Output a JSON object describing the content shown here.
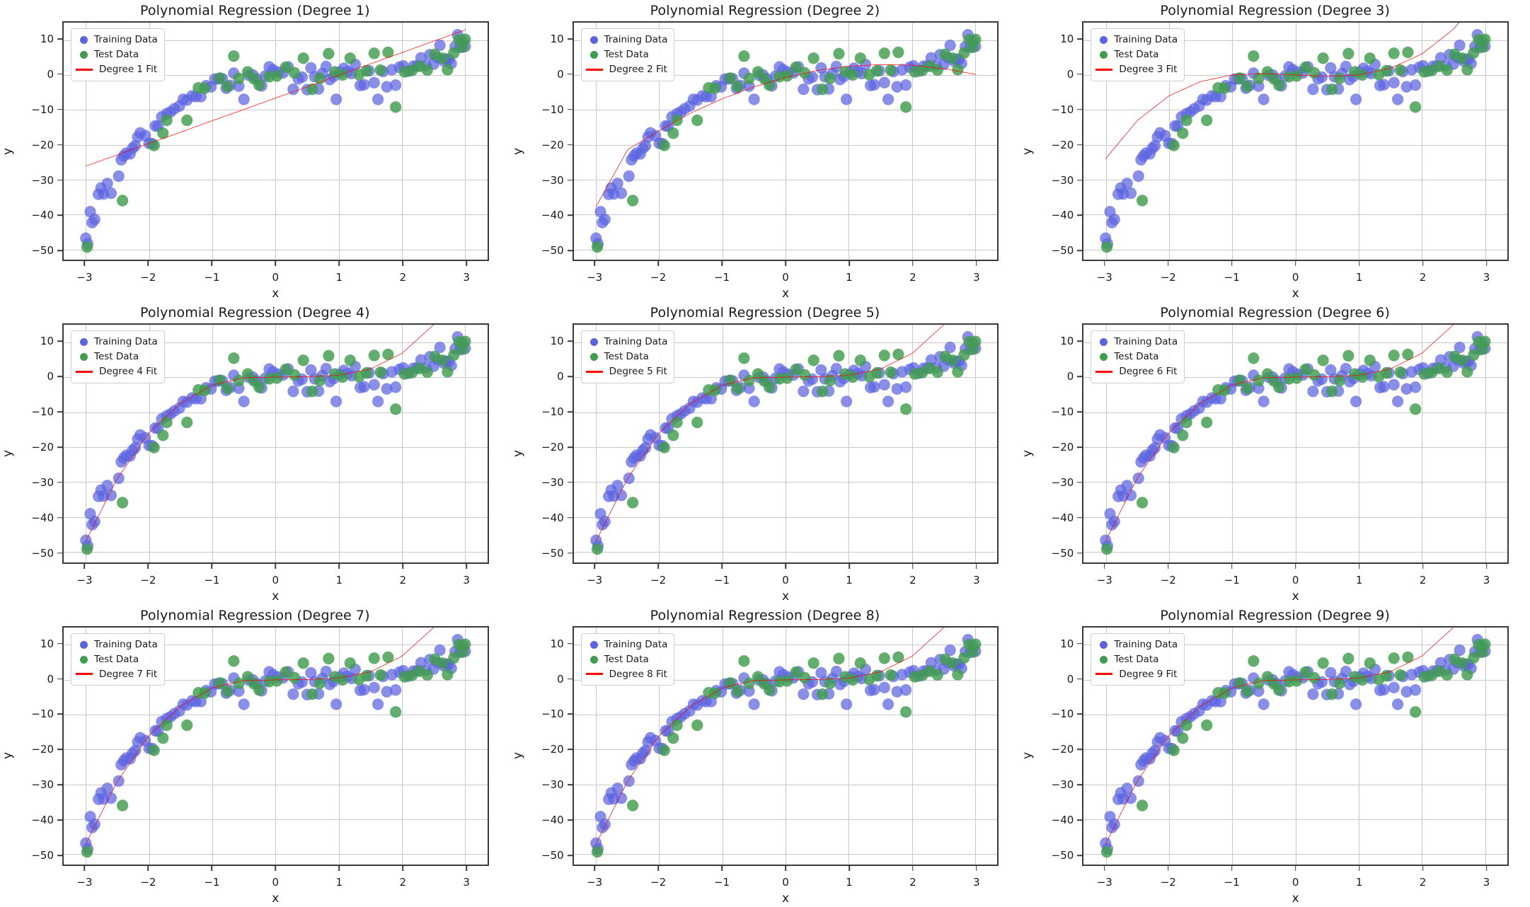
{
  "figure": {
    "layout": "3x3 grid of subplots",
    "rows": 3,
    "cols": 3
  },
  "style": {
    "train_color": "#5B64E0",
    "test_color": "#3F9E4D",
    "fit_color": "#FF0000",
    "grid_color": "#c9c9c9",
    "spine_color": "#3a3a3a",
    "background": "#ffffff"
  },
  "axes_common": {
    "xlabel": "x",
    "ylabel": "y",
    "xticks": [
      "−3",
      "−2",
      "−1",
      "0",
      "1",
      "2",
      "3"
    ],
    "xtick_values": [
      -3,
      -2,
      -1,
      0,
      1,
      2,
      3
    ],
    "yticks": [
      "−50",
      "−40",
      "−30",
      "−20",
      "−10",
      "0",
      "10"
    ],
    "ytick_values": [
      -50,
      -40,
      -30,
      -20,
      -10,
      0,
      10
    ],
    "xlim": [
      -3.35,
      3.35
    ],
    "ylim": [
      -53,
      15
    ],
    "grid": true
  },
  "legend_common": {
    "position": "upper left",
    "train_label": "Training Data",
    "test_label": "Test Data",
    "fit_label_template": "Degree {n} Fit"
  },
  "chart_data": [
    {
      "type": "scatter",
      "index": 0,
      "degree": 1,
      "title": "Polynomial Regression (Degree 1)",
      "xlabel": "x",
      "ylabel": "y",
      "xlim": [
        -3.35,
        3.35
      ],
      "ylim": [
        -53,
        15
      ],
      "grid": true,
      "legend": {
        "position": "upper left",
        "entries": [
          "Training Data",
          "Test Data",
          "Degree 1 Fit"
        ]
      },
      "series": [
        {
          "name": "Training Data",
          "marker": "circle",
          "color": "#5B64E0"
        },
        {
          "name": "Test Data",
          "marker": "circle",
          "color": "#3F9E4D"
        },
        {
          "name": "Degree 1 Fit",
          "marker": "line",
          "color": "#FF0000"
        }
      ],
      "fit_coefficients_highest_first": [
        6.5,
        -6.6
      ],
      "fit_curve_x": [
        -3.0,
        -2.5,
        -2.0,
        -1.5,
        -1.0,
        -0.5,
        0.0,
        0.5,
        1.0,
        1.5,
        2.0,
        2.5,
        3.0
      ],
      "fit_curve_y": [
        -26.1,
        -22.9,
        -19.6,
        -16.4,
        -13.1,
        -9.9,
        -6.6,
        -3.4,
        -0.1,
        3.2,
        6.4,
        9.7,
        12.9
      ]
    },
    {
      "type": "scatter",
      "index": 1,
      "degree": 2,
      "title": "Polynomial Regression (Degree 2)",
      "xlabel": "x",
      "ylabel": "y",
      "xlim": [
        -3.35,
        3.35
      ],
      "ylim": [
        -53,
        15
      ],
      "grid": true,
      "legend": {
        "position": "upper left",
        "entries": [
          "Training Data",
          "Test Data",
          "Degree 2 Fit"
        ]
      },
      "series": [
        {
          "name": "Training Data",
          "marker": "circle",
          "color": "#5B64E0"
        },
        {
          "name": "Test Data",
          "marker": "circle",
          "color": "#3F9E4D"
        },
        {
          "name": "Degree 2 Fit",
          "marker": "line",
          "color": "#FF0000"
        }
      ],
      "fit_coefficients_highest_first": [
        -1.45,
        4.65,
        -0.7
      ],
      "fit_curve_x": [
        -3.0,
        -2.5,
        -2.0,
        -1.5,
        -1.0,
        -0.5,
        0.0,
        0.5,
        1.0,
        1.5,
        2.0,
        2.5,
        3.0
      ],
      "fit_curve_y": [
        -37.7,
        -21.4,
        -16.0,
        -10.9,
        -6.8,
        -3.4,
        -0.7,
        1.3,
        2.5,
        3.0,
        2.8,
        1.8,
        0.2
      ]
    },
    {
      "type": "scatter",
      "index": 2,
      "degree": 3,
      "title": "Polynomial Regression (Degree 3)",
      "xlabel": "x",
      "ylabel": "y",
      "xlim": [
        -3.35,
        3.35
      ],
      "ylim": [
        -53,
        15
      ],
      "grid": true,
      "legend": {
        "position": "upper left",
        "entries": [
          "Training Data",
          "Test Data",
          "Degree 3 Fit"
        ]
      },
      "series": [
        {
          "name": "Training Data",
          "marker": "circle",
          "color": "#5B64E0"
        },
        {
          "name": "Test Data",
          "marker": "circle",
          "color": "#3F9E4D"
        },
        {
          "name": "Degree 3 Fit",
          "marker": "line",
          "color": "#FF0000"
        }
      ],
      "fit_coefficients_highest_first": [
        1.0,
        0.0,
        -1.0,
        0.0
      ],
      "fit_curve_x": [
        -3.0,
        -2.5,
        -2.0,
        -1.5,
        -1.0,
        -0.5,
        0.0,
        0.5,
        1.0,
        1.5,
        2.0,
        2.5,
        3.0
      ],
      "fit_curve_y": [
        -24.0,
        -13.1,
        -6.0,
        -1.9,
        0.0,
        0.4,
        0.0,
        -0.4,
        0.0,
        1.9,
        6.0,
        13.1,
        24.0
      ]
    },
    {
      "type": "scatter",
      "index": 3,
      "degree": 4,
      "title": "Polynomial Regression (Degree 4)",
      "xlabel": "x",
      "ylabel": "y",
      "xlim": [
        -3.35,
        3.35
      ],
      "ylim": [
        -53,
        15
      ],
      "grid": true,
      "legend": {
        "position": "upper left",
        "entries": [
          "Training Data",
          "Test Data",
          "Degree 4 Fit"
        ]
      },
      "series": [
        {
          "name": "Training Data",
          "marker": "circle",
          "color": "#5B64E0"
        },
        {
          "name": "Test Data",
          "marker": "circle",
          "color": "#3F9E4D"
        },
        {
          "name": "Degree 4 Fit",
          "marker": "line",
          "color": "#FF0000"
        }
      ],
      "fit_coefficients_highest_first": [
        0.0,
        1.0,
        0.0,
        -1.0,
        0.0
      ],
      "fit_curve_x": [
        -3.0,
        -2.5,
        -2.0,
        -1.5,
        -1.0,
        -0.5,
        0.0,
        0.5,
        1.0,
        1.5,
        2.0,
        2.5,
        3.0
      ],
      "fit_curve_y": [
        -47.0,
        -29.0,
        -16.0,
        -7.5,
        -2.3,
        -0.2,
        0.0,
        0.1,
        0.5,
        2.3,
        6.8,
        15.0,
        26.0
      ]
    },
    {
      "type": "scatter",
      "index": 4,
      "degree": 5,
      "title": "Polynomial Regression (Degree 5)",
      "xlabel": "x",
      "ylabel": "y",
      "xlim": [
        -3.35,
        3.35
      ],
      "ylim": [
        -53,
        15
      ],
      "grid": true,
      "legend": {
        "position": "upper left",
        "entries": [
          "Training Data",
          "Test Data",
          "Degree 5 Fit"
        ]
      },
      "series": [
        {
          "name": "Training Data",
          "marker": "circle",
          "color": "#5B64E0"
        },
        {
          "name": "Test Data",
          "marker": "circle",
          "color": "#3F9E4D"
        },
        {
          "name": "Degree 5 Fit",
          "marker": "line",
          "color": "#FF0000"
        }
      ],
      "fit_coefficients_highest_first": [
        0.0,
        0.0,
        1.0,
        0.0,
        -1.0,
        0.0
      ],
      "fit_curve_x": [
        -3.0,
        -2.5,
        -2.0,
        -1.5,
        -1.0,
        -0.5,
        0.0,
        0.5,
        1.0,
        1.5,
        2.0,
        2.5,
        3.0
      ],
      "fit_curve_y": [
        -47.0,
        -29.0,
        -16.0,
        -7.5,
        -2.3,
        -0.2,
        0.0,
        0.1,
        0.5,
        2.3,
        6.8,
        15.0,
        26.0
      ]
    },
    {
      "type": "scatter",
      "index": 5,
      "degree": 6,
      "title": "Polynomial Regression (Degree 6)",
      "xlabel": "x",
      "ylabel": "y",
      "xlim": [
        -3.35,
        3.35
      ],
      "ylim": [
        -53,
        15
      ],
      "grid": true,
      "legend": {
        "position": "upper left",
        "entries": [
          "Training Data",
          "Test Data",
          "Degree 6 Fit"
        ]
      },
      "series": [
        {
          "name": "Training Data",
          "marker": "circle",
          "color": "#5B64E0"
        },
        {
          "name": "Test Data",
          "marker": "circle",
          "color": "#3F9E4D"
        },
        {
          "name": "Degree 6 Fit",
          "marker": "line",
          "color": "#FF0000"
        }
      ],
      "fit_coefficients_highest_first": [
        0.0,
        0.0,
        0.0,
        1.0,
        0.0,
        -1.0,
        0.0
      ],
      "fit_curve_x": [
        -3.0,
        -2.5,
        -2.0,
        -1.5,
        -1.0,
        -0.5,
        0.0,
        0.5,
        1.0,
        1.5,
        2.0,
        2.5,
        3.0
      ],
      "fit_curve_y": [
        -47.0,
        -29.0,
        -16.0,
        -7.5,
        -2.3,
        -0.2,
        0.0,
        0.1,
        0.5,
        2.3,
        6.8,
        15.0,
        26.0
      ]
    },
    {
      "type": "scatter",
      "index": 6,
      "degree": 7,
      "title": "Polynomial Regression (Degree 7)",
      "xlabel": "x",
      "ylabel": "y",
      "xlim": [
        -3.35,
        3.35
      ],
      "ylim": [
        -53,
        15
      ],
      "grid": true,
      "legend": {
        "position": "upper left",
        "entries": [
          "Training Data",
          "Test Data",
          "Degree 7 Fit"
        ]
      },
      "series": [
        {
          "name": "Training Data",
          "marker": "circle",
          "color": "#5B64E0"
        },
        {
          "name": "Test Data",
          "marker": "circle",
          "color": "#3F9E4D"
        },
        {
          "name": "Degree 7 Fit",
          "marker": "line",
          "color": "#FF0000"
        }
      ],
      "fit_coefficients_highest_first": [
        0.0,
        0.0,
        0.0,
        0.0,
        1.0,
        0.0,
        -1.0,
        0.0
      ],
      "fit_curve_x": [
        -3.0,
        -2.5,
        -2.0,
        -1.5,
        -1.0,
        -0.5,
        0.0,
        0.5,
        1.0,
        1.5,
        2.0,
        2.5,
        3.0
      ],
      "fit_curve_y": [
        -47.0,
        -29.0,
        -16.0,
        -7.5,
        -2.3,
        -0.2,
        0.0,
        0.1,
        0.5,
        2.3,
        6.8,
        15.0,
        26.0
      ]
    },
    {
      "type": "scatter",
      "index": 7,
      "degree": 8,
      "title": "Polynomial Regression (Degree 8)",
      "xlabel": "x",
      "ylabel": "y",
      "xlim": [
        -3.35,
        3.35
      ],
      "ylim": [
        -53,
        15
      ],
      "grid": true,
      "legend": {
        "position": "upper left",
        "entries": [
          "Training Data",
          "Test Data",
          "Degree 8 Fit"
        ]
      },
      "series": [
        {
          "name": "Training Data",
          "marker": "circle",
          "color": "#5B64E0"
        },
        {
          "name": "Test Data",
          "marker": "circle",
          "color": "#3F9E4D"
        },
        {
          "name": "Degree 8 Fit",
          "marker": "line",
          "color": "#FF0000"
        }
      ],
      "fit_coefficients_highest_first": [
        0.0,
        0.0,
        0.0,
        0.0,
        0.0,
        1.0,
        0.0,
        -1.0,
        0.0
      ],
      "fit_curve_x": [
        -3.0,
        -2.5,
        -2.0,
        -1.5,
        -1.0,
        -0.5,
        0.0,
        0.5,
        1.0,
        1.5,
        2.0,
        2.5,
        3.0
      ],
      "fit_curve_y": [
        -47.0,
        -29.0,
        -16.0,
        -7.5,
        -2.3,
        -0.2,
        0.0,
        0.1,
        0.5,
        2.3,
        6.8,
        15.0,
        26.0
      ]
    },
    {
      "type": "scatter",
      "index": 8,
      "degree": 9,
      "title": "Polynomial Regression (Degree 9)",
      "xlabel": "x",
      "ylabel": "y",
      "xlim": [
        -3.35,
        3.35
      ],
      "ylim": [
        -53,
        15
      ],
      "grid": true,
      "legend": {
        "position": "upper left",
        "entries": [
          "Training Data",
          "Test Data",
          "Degree 9 Fit"
        ]
      },
      "series": [
        {
          "name": "Training Data",
          "marker": "circle",
          "color": "#5B64E0"
        },
        {
          "name": "Test Data",
          "marker": "circle",
          "color": "#3F9E4D"
        },
        {
          "name": "Degree 9 Fit",
          "marker": "line",
          "color": "#FF0000"
        }
      ],
      "fit_coefficients_highest_first": [
        0.0,
        0.0,
        0.0,
        0.0,
        0.0,
        0.0,
        1.0,
        0.0,
        -1.0,
        0.0
      ],
      "fit_curve_x": [
        -3.0,
        -2.5,
        -2.0,
        -1.5,
        -1.0,
        -0.5,
        0.0,
        0.5,
        1.0,
        1.5,
        2.0,
        2.5,
        3.0
      ],
      "fit_curve_y": [
        -47.0,
        -29.0,
        -16.0,
        -7.5,
        -2.3,
        -0.2,
        0.0,
        0.1,
        0.5,
        2.3,
        6.8,
        15.0,
        26.0
      ]
    }
  ],
  "points": {
    "train": [
      [
        -3.0,
        -46.8
      ],
      [
        -2.97,
        -48.4
      ],
      [
        -2.93,
        -39.2
      ],
      [
        -2.9,
        -42.3
      ],
      [
        -2.86,
        -41.4
      ],
      [
        -2.8,
        -34.2
      ],
      [
        -2.76,
        -32.4
      ],
      [
        -2.72,
        -34.1
      ],
      [
        -2.66,
        -31.1
      ],
      [
        -2.6,
        -33.9
      ],
      [
        -2.48,
        -29.0
      ],
      [
        -2.44,
        -24.3
      ],
      [
        -2.4,
        -23.2
      ],
      [
        -2.36,
        -22.4
      ],
      [
        -2.3,
        -22.6
      ],
      [
        -2.26,
        -21.0
      ],
      [
        -2.22,
        -20.3
      ],
      [
        -2.18,
        -17.8
      ],
      [
        -2.14,
        -16.6
      ],
      [
        -2.06,
        -17.4
      ],
      [
        -2.0,
        -19.6
      ],
      [
        -1.95,
        -19.7
      ],
      [
        -1.9,
        -14.6
      ],
      [
        -1.86,
        -14.7
      ],
      [
        -1.8,
        -12.0
      ],
      [
        -1.72,
        -11.1
      ],
      [
        -1.66,
        -10.6
      ],
      [
        -1.6,
        -9.7
      ],
      [
        -1.52,
        -8.9
      ],
      [
        -1.46,
        -7.0
      ],
      [
        -1.4,
        -7.2
      ],
      [
        -1.32,
        -6.0
      ],
      [
        -1.26,
        -6.2
      ],
      [
        -1.18,
        -6.2
      ],
      [
        -1.1,
        -3.1
      ],
      [
        -1.02,
        -3.4
      ],
      [
        -0.96,
        -1.2
      ],
      [
        -0.9,
        -1.1
      ],
      [
        -0.84,
        -1.1
      ],
      [
        -0.78,
        -3.8
      ],
      [
        -0.72,
        -3.0
      ],
      [
        -0.66,
        0.5
      ],
      [
        -0.58,
        -3.2
      ],
      [
        -0.5,
        -7.0
      ],
      [
        -0.42,
        -0.1
      ],
      [
        -0.36,
        0.0
      ],
      [
        -0.3,
        -1.1
      ],
      [
        -0.22,
        -3.1
      ],
      [
        -0.16,
        -0.3
      ],
      [
        -0.1,
        2.3
      ],
      [
        -0.04,
        1.5
      ],
      [
        0.04,
        0.8
      ],
      [
        0.12,
        0.6
      ],
      [
        0.2,
        2.3
      ],
      [
        0.28,
        -4.1
      ],
      [
        0.36,
        -1.1
      ],
      [
        0.42,
        -0.6
      ],
      [
        0.5,
        -4.2
      ],
      [
        0.56,
        2.0
      ],
      [
        0.62,
        -0.5
      ],
      [
        0.68,
        -4.0
      ],
      [
        0.74,
        0.4
      ],
      [
        0.8,
        2.4
      ],
      [
        0.86,
        -1.3
      ],
      [
        0.92,
        -0.4
      ],
      [
        0.96,
        -7.0
      ],
      [
        1.02,
        0.8
      ],
      [
        1.08,
        1.9
      ],
      [
        1.14,
        1.0
      ],
      [
        1.2,
        0.4
      ],
      [
        1.26,
        3.0
      ],
      [
        1.34,
        -3.0
      ],
      [
        1.4,
        -2.8
      ],
      [
        1.48,
        1.2
      ],
      [
        1.56,
        -2.2
      ],
      [
        1.62,
        -7.0
      ],
      [
        1.7,
        1.0
      ],
      [
        1.76,
        -3.4
      ],
      [
        1.84,
        1.5
      ],
      [
        1.9,
        -2.9
      ],
      [
        1.96,
        2.2
      ],
      [
        2.02,
        2.6
      ],
      [
        2.1,
        1.1
      ],
      [
        2.18,
        2.5
      ],
      [
        2.24,
        2.6
      ],
      [
        2.3,
        4.9
      ],
      [
        2.38,
        2.7
      ],
      [
        2.44,
        5.8
      ],
      [
        2.5,
        3.1
      ],
      [
        2.56,
        5.0
      ],
      [
        2.6,
        8.5
      ],
      [
        2.66,
        4.0
      ],
      [
        2.7,
        4.5
      ],
      [
        2.74,
        4.5
      ],
      [
        2.78,
        3.3
      ],
      [
        2.84,
        8.1
      ],
      [
        2.88,
        11.5
      ],
      [
        2.92,
        7.9
      ],
      [
        2.96,
        9.7
      ],
      [
        3.0,
        8.2
      ]
    ],
    "test": [
      [
        -2.98,
        -49.3
      ],
      [
        -2.42,
        -36.0
      ],
      [
        -1.92,
        -20.2
      ],
      [
        -1.78,
        -16.7
      ],
      [
        -1.72,
        -13.0
      ],
      [
        -1.4,
        -13.0
      ],
      [
        -1.22,
        -3.7
      ],
      [
        -1.12,
        -3.8
      ],
      [
        -0.88,
        -0.9
      ],
      [
        -0.76,
        -3.3
      ],
      [
        -0.66,
        5.4
      ],
      [
        -0.58,
        -1.0
      ],
      [
        -0.44,
        0.9
      ],
      [
        -0.34,
        -1.1
      ],
      [
        -0.26,
        -2.9
      ],
      [
        -0.1,
        -0.5
      ],
      [
        0.02,
        -0.3
      ],
      [
        0.16,
        2.2
      ],
      [
        0.3,
        0.6
      ],
      [
        0.44,
        4.8
      ],
      [
        0.58,
        -4.1
      ],
      [
        0.7,
        -1.0
      ],
      [
        0.84,
        6.1
      ],
      [
        0.94,
        0.9
      ],
      [
        1.06,
        0.0
      ],
      [
        1.18,
        4.8
      ],
      [
        1.32,
        0.1
      ],
      [
        1.44,
        1.2
      ],
      [
        1.56,
        6.2
      ],
      [
        1.66,
        1.4
      ],
      [
        1.78,
        6.5
      ],
      [
        1.9,
        -9.2
      ],
      [
        2.04,
        0.9
      ],
      [
        2.16,
        1.3
      ],
      [
        2.28,
        2.5
      ],
      [
        2.4,
        1.4
      ],
      [
        2.52,
        5.9
      ],
      [
        2.64,
        4.8
      ],
      [
        2.72,
        1.5
      ],
      [
        2.82,
        6.3
      ],
      [
        2.9,
        10.1
      ],
      [
        2.96,
        8.0
      ],
      [
        3.0,
        10.2
      ]
    ]
  }
}
